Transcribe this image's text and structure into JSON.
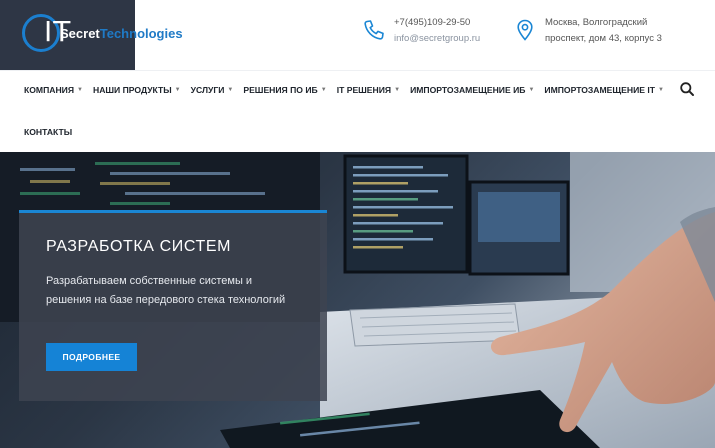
{
  "brand": {
    "logo_mark": "IT",
    "name_part1": "Secret",
    "name_part2": "Technologies",
    "accent_color": "#1b7fcf",
    "logo_bg": "#2e3645"
  },
  "contacts": {
    "phone": "+7(495)109-29-50",
    "email": "info@secretgroup.ru",
    "address_line1": "Москва, Волгоградский",
    "address_line2": "проспект, дом 43, корпус 3",
    "phone_icon": "phone-icon",
    "address_icon": "map-pin-icon"
  },
  "nav": {
    "items": [
      {
        "label": "КОМПАНИЯ",
        "has_dropdown": true
      },
      {
        "label": "НАШИ ПРОДУКТЫ",
        "has_dropdown": true
      },
      {
        "label": "УСЛУГИ",
        "has_dropdown": true
      },
      {
        "label": "РЕШЕНИЯ ПО ИБ",
        "has_dropdown": true
      },
      {
        "label": "IT РЕШЕНИЯ",
        "has_dropdown": true
      },
      {
        "label": "ИМПОРТОЗАМЕЩЕНИЕ ИБ",
        "has_dropdown": true
      },
      {
        "label": "ИМПОРТОЗАМЕЩЕНИЕ IT",
        "has_dropdown": true
      },
      {
        "label": "КОНТАКТЫ",
        "has_dropdown": false
      }
    ],
    "caret": "▼",
    "search_icon": "search-icon"
  },
  "hero": {
    "title": "РАЗРАБОТКА СИСТЕМ",
    "description": "Разрабатываем собственные системы и решения на базе передового стека технологий",
    "button_label": "ПОДРОБНЕЕ",
    "button_color": "#1583d6"
  }
}
